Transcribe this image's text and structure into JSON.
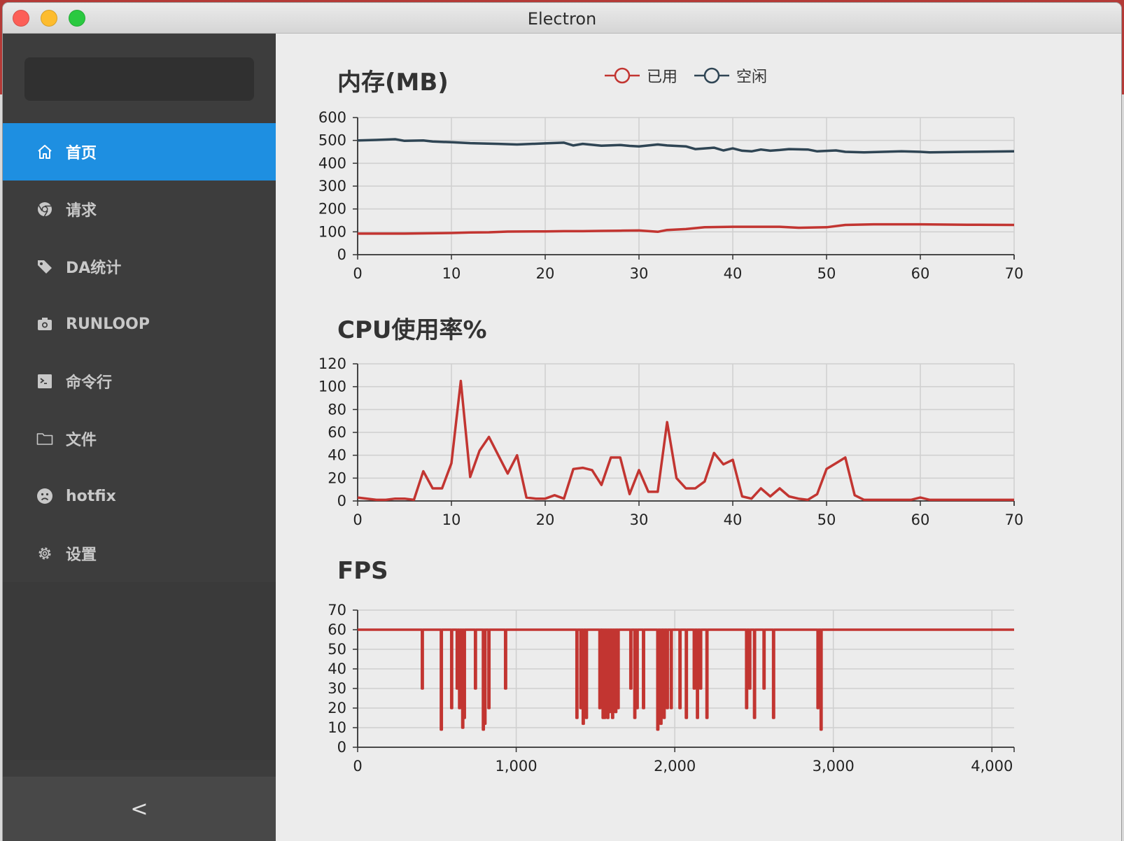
{
  "window": {
    "title": "Electron"
  },
  "sidebar": {
    "items": [
      {
        "label": "首页",
        "icon": "home-icon",
        "active": true
      },
      {
        "label": "请求",
        "icon": "chrome-icon",
        "active": false
      },
      {
        "label": "DA统计",
        "icon": "tag-icon",
        "active": false
      },
      {
        "label": "RUNLOOP",
        "icon": "camera-icon",
        "active": false
      },
      {
        "label": "命令行",
        "icon": "terminal-icon",
        "active": false
      },
      {
        "label": "文件",
        "icon": "folder-icon",
        "active": false
      },
      {
        "label": "hotfix",
        "icon": "frown-icon",
        "active": false
      },
      {
        "label": "设置",
        "icon": "gear-icon",
        "active": false
      }
    ],
    "collapse_label": "<"
  },
  "colors": {
    "used": "#c23531",
    "free": "#2f4554",
    "accent": "#1e8fe1"
  },
  "chart_data": [
    {
      "type": "line",
      "title": "内存(MB)",
      "legend": [
        "已用",
        "空闲"
      ],
      "xlim": [
        0,
        70
      ],
      "ylim": [
        0,
        600
      ],
      "xticks": [
        0,
        10,
        20,
        30,
        40,
        50,
        60,
        70
      ],
      "yticks": [
        0,
        100,
        200,
        300,
        400,
        500,
        600
      ],
      "series": [
        {
          "name": "已用",
          "x": [
            0,
            5,
            10,
            12,
            14,
            16,
            20,
            22,
            24,
            26,
            28,
            30,
            32,
            33,
            35,
            37,
            40,
            42,
            45,
            47,
            50,
            52,
            55,
            60,
            65,
            70
          ],
          "values": [
            92,
            92,
            95,
            97,
            98,
            101,
            102,
            103,
            103,
            104,
            105,
            106,
            100,
            108,
            112,
            120,
            122,
            122,
            122,
            118,
            120,
            130,
            133,
            133,
            131,
            130
          ]
        },
        {
          "name": "空闲",
          "x": [
            0,
            2,
            4,
            5,
            7,
            8,
            10,
            12,
            15,
            17,
            20,
            22,
            23,
            24,
            26,
            28,
            29,
            30,
            32,
            33,
            35,
            36,
            38,
            39,
            40,
            41,
            42,
            43,
            44,
            45,
            46,
            48,
            49,
            51,
            52,
            54,
            56,
            58,
            60,
            61,
            65,
            70
          ],
          "values": [
            500,
            502,
            505,
            498,
            500,
            495,
            492,
            488,
            485,
            482,
            487,
            490,
            478,
            485,
            477,
            480,
            476,
            474,
            482,
            478,
            474,
            462,
            468,
            456,
            465,
            455,
            452,
            460,
            455,
            458,
            462,
            460,
            452,
            456,
            450,
            448,
            450,
            452,
            450,
            448,
            450,
            452
          ]
        }
      ]
    },
    {
      "type": "line",
      "title": "CPU使用率%",
      "xlim": [
        0,
        70
      ],
      "ylim": [
        0,
        120
      ],
      "xticks": [
        0,
        10,
        20,
        30,
        40,
        50,
        60,
        70
      ],
      "yticks": [
        0,
        20,
        40,
        60,
        80,
        100,
        120
      ],
      "series": [
        {
          "name": "",
          "x": [
            0,
            1,
            2,
            3,
            4,
            5,
            6,
            7,
            8,
            9,
            10,
            11,
            12,
            13,
            14,
            15,
            16,
            17,
            18,
            19,
            20,
            21,
            22,
            23,
            24,
            25,
            26,
            27,
            28,
            29,
            30,
            31,
            32,
            33,
            34,
            35,
            36,
            37,
            38,
            39,
            40,
            41,
            42,
            43,
            44,
            45,
            46,
            47,
            48,
            49,
            50,
            51,
            52,
            53,
            54,
            55,
            56,
            57,
            58,
            59,
            60,
            61,
            62,
            63,
            64,
            65,
            66,
            67,
            68,
            69,
            70
          ],
          "values": [
            3,
            2,
            1,
            1,
            2,
            2,
            1,
            26,
            11,
            11,
            33,
            105,
            21,
            44,
            56,
            40,
            24,
            40,
            3,
            2,
            2,
            5,
            2,
            28,
            29,
            27,
            14,
            38,
            38,
            6,
            27,
            8,
            8,
            69,
            20,
            11,
            11,
            17,
            42,
            32,
            36,
            4,
            2,
            11,
            4,
            11,
            4,
            2,
            1,
            6,
            28,
            33,
            38,
            5,
            1,
            1,
            1,
            1,
            1,
            1,
            3,
            1,
            1,
            1,
            1,
            1,
            1,
            1,
            1,
            1,
            1
          ]
        }
      ]
    },
    {
      "type": "line",
      "title": "FPS",
      "xlim": [
        0,
        4140
      ],
      "ylim": [
        0,
        70
      ],
      "xticks": [
        0,
        1000,
        2000,
        3000,
        4000
      ],
      "xticklabels": [
        "0",
        "1,000",
        "2,000",
        "3,000",
        "4,000"
      ],
      "yticks": [
        0,
        10,
        20,
        30,
        40,
        50,
        60,
        70
      ],
      "baseline": 60,
      "dips": [
        [
          405,
          30
        ],
        [
          525,
          9
        ],
        [
          590,
          20
        ],
        [
          625,
          30
        ],
        [
          640,
          20
        ],
        [
          650,
          30
        ],
        [
          660,
          10
        ],
        [
          670,
          15
        ],
        [
          740,
          30
        ],
        [
          790,
          9
        ],
        [
          800,
          12
        ],
        [
          825,
          20
        ],
        [
          930,
          30
        ],
        [
          1380,
          15
        ],
        [
          1405,
          20
        ],
        [
          1420,
          12
        ],
        [
          1440,
          15
        ],
        [
          1525,
          20
        ],
        [
          1545,
          15
        ],
        [
          1555,
          15
        ],
        [
          1565,
          20
        ],
        [
          1575,
          15
        ],
        [
          1585,
          18
        ],
        [
          1595,
          20
        ],
        [
          1605,
          15
        ],
        [
          1615,
          20
        ],
        [
          1625,
          18
        ],
        [
          1640,
          20
        ],
        [
          1720,
          30
        ],
        [
          1745,
          15
        ],
        [
          1760,
          20
        ],
        [
          1800,
          20
        ],
        [
          1890,
          9
        ],
        [
          1910,
          12
        ],
        [
          1930,
          15
        ],
        [
          1950,
          20
        ],
        [
          1975,
          20
        ],
        [
          2030,
          20
        ],
        [
          2070,
          15
        ],
        [
          2120,
          30
        ],
        [
          2140,
          15
        ],
        [
          2160,
          30
        ],
        [
          2200,
          15
        ],
        [
          2450,
          20
        ],
        [
          2470,
          30
        ],
        [
          2500,
          15
        ],
        [
          2560,
          30
        ],
        [
          2620,
          15
        ],
        [
          2900,
          20
        ],
        [
          2920,
          9
        ]
      ],
      "series": [
        {
          "name": ""
        }
      ]
    }
  ]
}
